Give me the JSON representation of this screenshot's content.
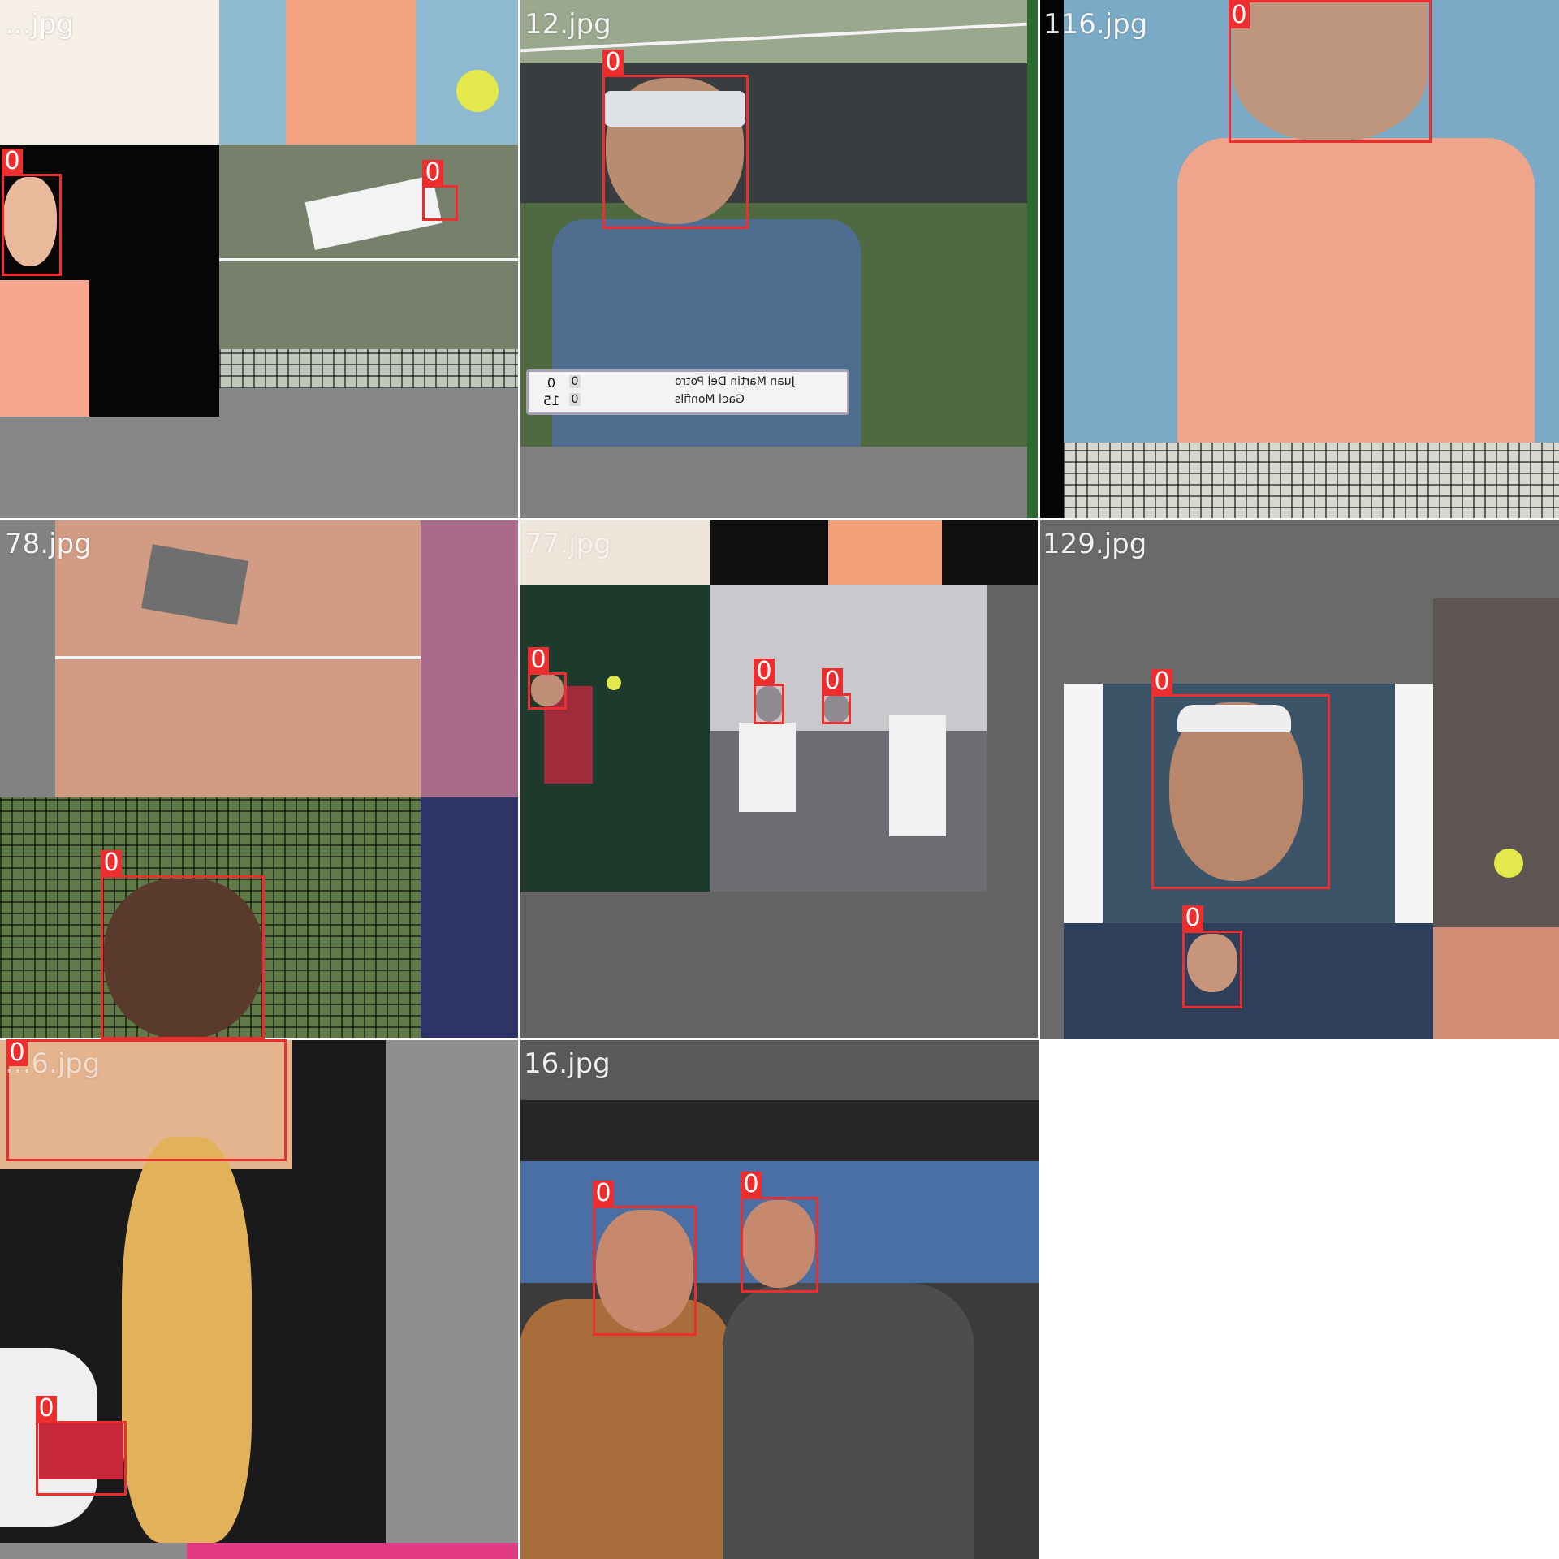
{
  "mosaic": {
    "class_label": "0",
    "tiles": [
      {
        "id": "tile-1",
        "filename": "...jpg"
      },
      {
        "id": "tile-2",
        "filename": "12.jpg"
      },
      {
        "id": "tile-3",
        "filename": "116.jpg"
      },
      {
        "id": "tile-4",
        "filename": "78.jpg"
      },
      {
        "id": "tile-5",
        "filename": "77.jpg"
      },
      {
        "id": "tile-6",
        "filename": "129.jpg"
      },
      {
        "id": "tile-7",
        "filename": "...6.jpg"
      },
      {
        "id": "tile-8",
        "filename": "16.jpg"
      }
    ]
  },
  "scoreboard": {
    "player1": "Juan Martin Del Potro",
    "player2": "Gael Monfils",
    "p1_points": "0",
    "p2_points": "15",
    "p1_games": "0",
    "p2_games": "0"
  },
  "colors": {
    "box": "#ee2e2e",
    "label_text": "#ffffff",
    "background": "#ffffff",
    "letterbox": "#7c7c7c"
  }
}
